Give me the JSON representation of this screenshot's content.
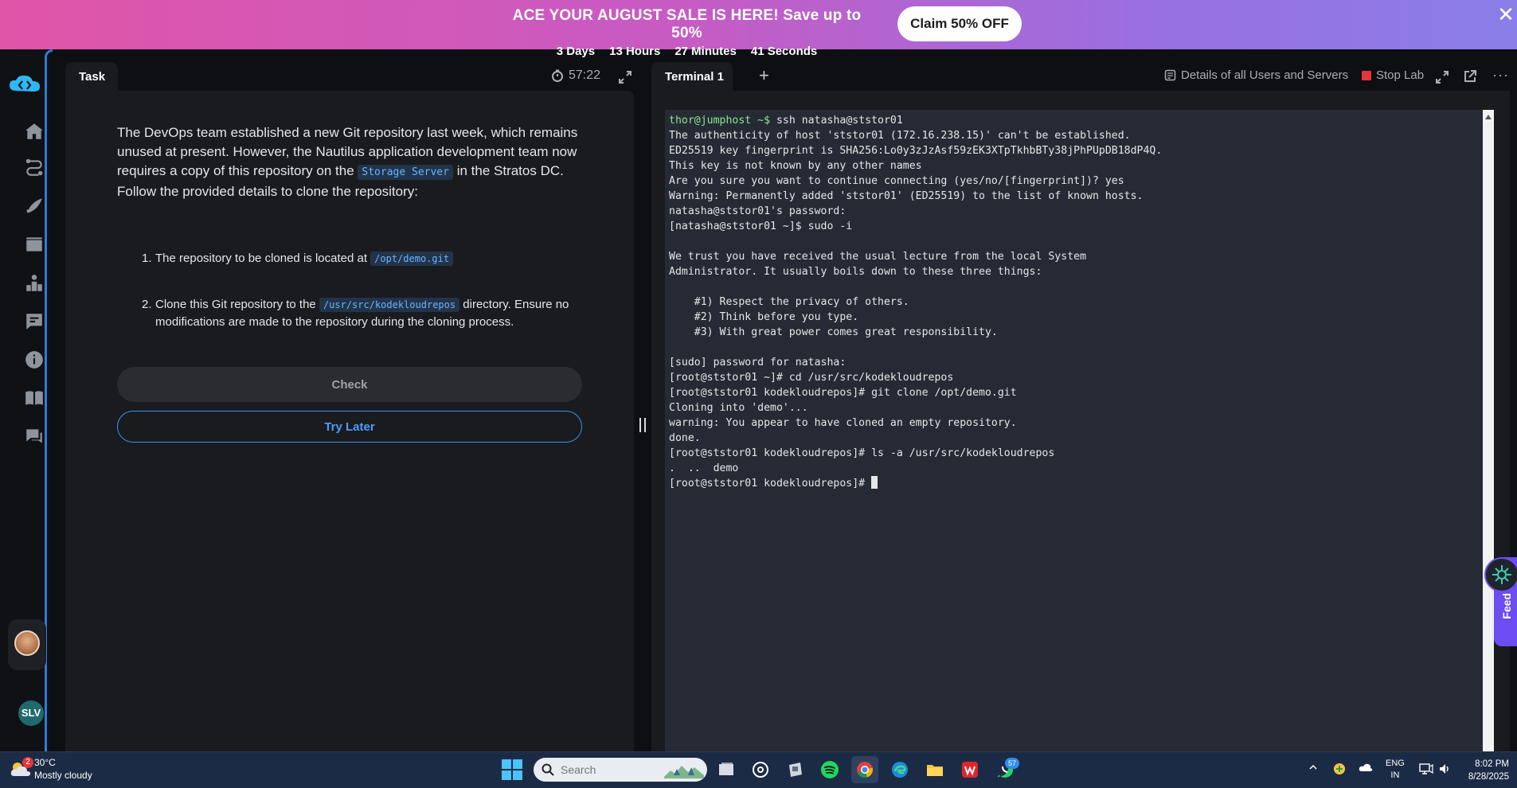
{
  "promo": {
    "headline": "ACE YOUR AUGUST SALE IS HERE!  Save up to 50%",
    "countdown": [
      "3 Days",
      "13 Hours",
      "27 Minutes",
      "41 Seconds"
    ],
    "cta_label": "Claim 50% OFF",
    "close_icon": "close-icon"
  },
  "sidebar": {
    "items": [
      "home-icon",
      "route-icon",
      "rocket-icon",
      "video-icon",
      "leaderboard-icon",
      "notes-icon",
      "info-icon",
      "book-icon",
      "chat-icon"
    ],
    "user_initials": "SLV"
  },
  "task": {
    "tab_label": "Task",
    "timer": "57:22",
    "description_parts": [
      "The DevOps team established a new Git repository last week, which remains unused at present. However, the Nautilus application development team now requires a copy of this repository on the ",
      "Storage Server",
      " in the Stratos DC. Follow the provided details to clone the repository:"
    ],
    "steps": [
      {
        "num": "1.",
        "before": "The repository to be cloned is located at ",
        "code": "/opt/demo.git",
        "after": ""
      },
      {
        "num": "2.",
        "before": "Clone this Git repository to the ",
        "code": "/usr/src/kodekloudrepos",
        "after": " directory. Ensure no modifications are made to the repository during the cloning process."
      }
    ],
    "check_label": "Check",
    "later_label": "Try Later"
  },
  "terminal": {
    "tab_label": "Terminal 1",
    "add_label": "+",
    "details_label": "Details of all Users and Servers",
    "stop_label": "Stop Lab",
    "lines": [
      {
        "prompt": "thor@jumphost ~$",
        "text": " ssh natasha@ststor01"
      },
      {
        "prompt": "",
        "text": "The authenticity of host 'ststor01 (172.16.238.15)' can't be established."
      },
      {
        "prompt": "",
        "text": "ED25519 key fingerprint is SHA256:Lo0y3zJzAsf59zEK3XTpTkhbBTy38jPhPUpDB18dP4Q."
      },
      {
        "prompt": "",
        "text": "This key is not known by any other names"
      },
      {
        "prompt": "",
        "text": "Are you sure you want to continue connecting (yes/no/[fingerprint])? yes"
      },
      {
        "prompt": "",
        "text": "Warning: Permanently added 'ststor01' (ED25519) to the list of known hosts."
      },
      {
        "prompt": "",
        "text": "natasha@ststor01's password:"
      },
      {
        "prompt": "",
        "text": "[natasha@ststor01 ~]$ sudo -i"
      },
      {
        "prompt": "",
        "text": ""
      },
      {
        "prompt": "",
        "text": "We trust you have received the usual lecture from the local System"
      },
      {
        "prompt": "",
        "text": "Administrator. It usually boils down to these three things:"
      },
      {
        "prompt": "",
        "text": ""
      },
      {
        "prompt": "",
        "text": "    #1) Respect the privacy of others."
      },
      {
        "prompt": "",
        "text": "    #2) Think before you type."
      },
      {
        "prompt": "",
        "text": "    #3) With great power comes great responsibility."
      },
      {
        "prompt": "",
        "text": ""
      },
      {
        "prompt": "",
        "text": "[sudo] password for natasha:"
      },
      {
        "prompt": "",
        "text": "[root@ststor01 ~]# cd /usr/src/kodekloudrepos"
      },
      {
        "prompt": "",
        "text": "[root@ststor01 kodekloudrepos]# git clone /opt/demo.git"
      },
      {
        "prompt": "",
        "text": "Cloning into 'demo'..."
      },
      {
        "prompt": "",
        "text": "warning: You appear to have cloned an empty repository."
      },
      {
        "prompt": "",
        "text": "done."
      },
      {
        "prompt": "",
        "text": "[root@ststor01 kodekloudrepos]# ls -a /usr/src/kodekloudrepos"
      },
      {
        "prompt": "",
        "text": ".  ..  demo"
      },
      {
        "prompt": "",
        "text": "[root@ststor01 kodekloudrepos]# "
      }
    ]
  },
  "feedback": {
    "label": "Feed"
  },
  "taskbar": {
    "weather_badge": "2",
    "temperature": "30°C",
    "weather_desc": "Mostly cloudy",
    "search_placeholder": "Search",
    "whatsapp_badge": "57",
    "lang_line1": "ENG",
    "lang_line2": "IN",
    "time": "8:02 PM",
    "date": "8/28/2025"
  },
  "colors": {
    "accent": "#3d8ff0",
    "prompt_green": "#8de88d",
    "stop_red": "#e2363a",
    "feedback_purple": "#6b4df0"
  }
}
